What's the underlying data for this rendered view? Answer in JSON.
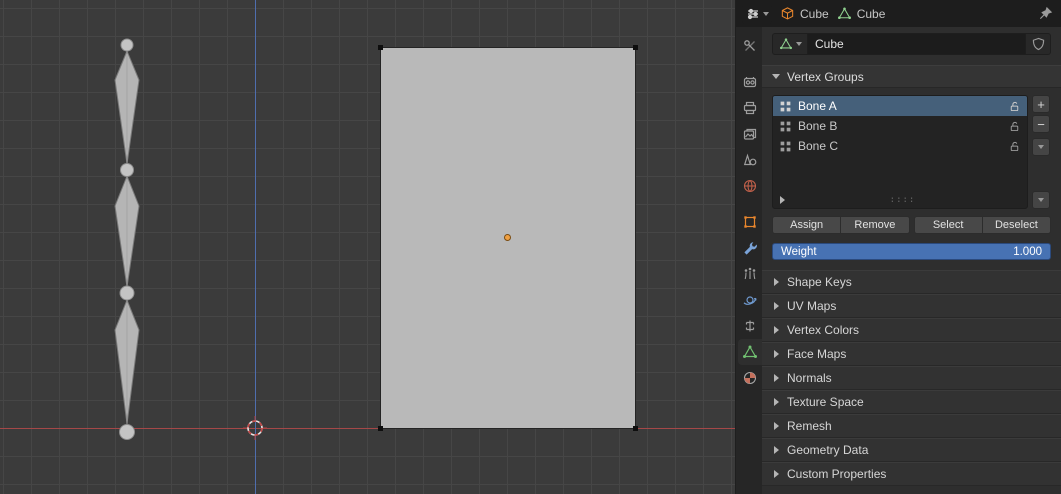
{
  "header": {
    "breadcrumb": [
      {
        "icon": "object-cube-icon",
        "label": "Cube"
      },
      {
        "icon": "mesh-data-icon",
        "label": "Cube"
      }
    ]
  },
  "tabs": [
    {
      "icon": "tool-icon",
      "active": false
    },
    {
      "icon": "render-icon",
      "active": false
    },
    {
      "icon": "output-icon",
      "active": false
    },
    {
      "icon": "view-layer-icon",
      "active": false
    },
    {
      "icon": "scene-icon",
      "active": false
    },
    {
      "icon": "world-icon",
      "active": false
    },
    {
      "icon": "object-icon",
      "active": false
    },
    {
      "icon": "modifiers-icon",
      "active": false
    },
    {
      "icon": "particles-icon",
      "active": false
    },
    {
      "icon": "physics-icon",
      "active": false
    },
    {
      "icon": "constraints-icon",
      "active": false
    },
    {
      "icon": "object-data-icon",
      "active": true
    },
    {
      "icon": "material-icon",
      "active": false
    }
  ],
  "datablock": {
    "name": "Cube"
  },
  "vertex_groups": {
    "title": "Vertex Groups",
    "items": [
      {
        "name": "Bone A",
        "selected": true
      },
      {
        "name": "Bone B",
        "selected": false
      },
      {
        "name": "Bone C",
        "selected": false
      }
    ],
    "list_buttons": {
      "add": "+",
      "remove": "−"
    },
    "actions": [
      "Assign",
      "Remove",
      "Select",
      "Deselect"
    ],
    "weight": {
      "label": "Weight",
      "value": "1.000"
    }
  },
  "panels": [
    "Shape Keys",
    "UV Maps",
    "Vertex Colors",
    "Face Maps",
    "Normals",
    "Texture Space",
    "Remesh",
    "Geometry Data",
    "Custom Properties"
  ],
  "colors": {
    "accent_blue": "#4772b3",
    "selection_blue": "#45607a",
    "object_orange": "#e8862d",
    "mesh_green": "#71c171",
    "axis_x_red": "#a54848",
    "axis_z_blue": "#4f6eae"
  }
}
